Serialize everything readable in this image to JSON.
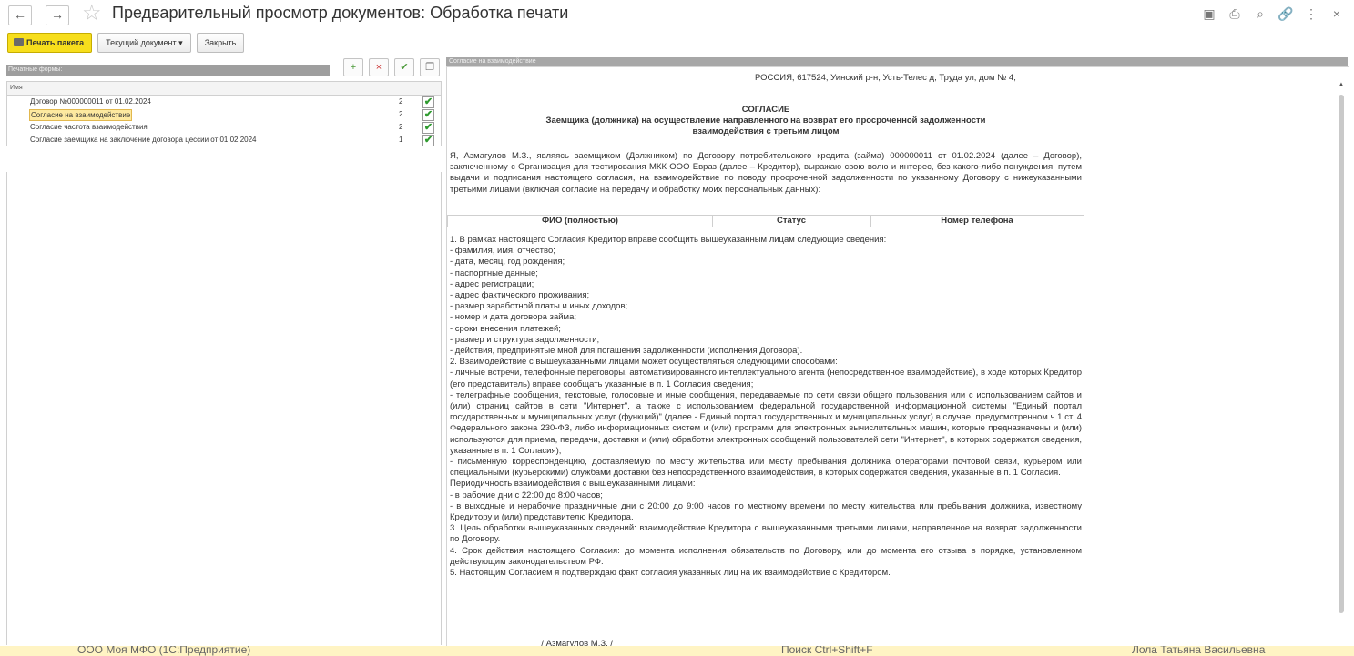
{
  "window": {
    "title": "Предварительный просмотр документов: Обработка печати",
    "nav_back": "←",
    "nav_forward": "→",
    "star": "☆",
    "header_icons": [
      "save-icon",
      "print-icon",
      "preview-icon",
      "link-icon",
      "more-icon",
      "close-icon"
    ],
    "header_icon_glyphs": [
      "▣",
      "⎙",
      "⌕",
      "🔗",
      "⋮",
      "×"
    ]
  },
  "toolbar": {
    "print_package": "Печать пакета",
    "current_document": "Текущий документ",
    "current_document_arrow": "▾",
    "close": "Закрыть"
  },
  "left_panel": {
    "header": "Печатные формы:",
    "icons": [
      "add-doc-icon",
      "delete-doc-icon",
      "check-all-icon",
      "copy-icon"
    ],
    "icon_glyphs": [
      "+",
      "×",
      "✔",
      "❐"
    ],
    "column_name": "Имя",
    "rows": [
      {
        "name": "Договор №000000011 от 01.02.2024",
        "count": "2",
        "checked": "✔"
      },
      {
        "name": "Согласие на взаимодействие",
        "count": "2",
        "checked": "✔"
      },
      {
        "name": "Согласие частота взаимодействия",
        "count": "2",
        "checked": "✔"
      },
      {
        "name": "Согласие заемщика на заключение договора цессии от 01.02.2024",
        "count": "1",
        "checked": "✔"
      }
    ]
  },
  "right_panel": {
    "header": "Согласие на взаимодействие"
  },
  "document": {
    "address": "РОССИЯ, 617524, Уинский р-н, Усть-Телес д, Труда ул, дом № 4,",
    "title": "СОГЛАСИЕ",
    "subtitle1": "Заемщика (должника) на осуществление направленного на возврат его просроченной задолженности",
    "subtitle2": "взаимодействия с третьим лицом",
    "intro": "Я, Азмагулов М.З., являясь заемщиком (Должником) по Договору потребительского кредита (займа) 000000011 от 01.02.2024 (далее – Договор), заключенному с Организация для тестирования МКК ООО Евраз (далее – Кредитор), выражаю свою волю и интерес, без какого-либо понуждения, путем выдачи и подписания настоящего согласия, на взаимодействие по поводу просроченной задолженности по указанному Договору с нижеуказанными третьими лицами (включая согласие на передачу и обработку моих персональных данных):",
    "table_headers": [
      "ФИО (полностью)",
      "Статус",
      "Номер телефона"
    ],
    "lines": [
      "1. В рамках настоящего Согласия Кредитор вправе сообщить вышеуказанным лицам следующие сведения:",
      "- фамилия, имя, отчество;",
      "- дата, месяц, год рождения;",
      "- паспортные данные;",
      "- адрес регистрации;",
      "- адрес фактического проживания;",
      "- размер заработной платы и иных доходов;",
      "- номер и дата договора займа;",
      "- сроки внесения платежей;",
      "- размер и структура задолженности;",
      "- действия, предпринятые мной для погашения задолженности (исполнения Договора).",
      "2. Взаимодействие с вышеуказанными лицами может осуществляться следующими способами:",
      "- личные встречи, телефонные переговоры, автоматизированного интеллектуального агента (непосредственное взаимодействие), в ходе которых Кредитор (его представитель) вправе сообщать указанные в п. 1 Согласия сведения;",
      "- телеграфные сообщения, текстовые, голосовые и иные сообщения, передаваемые по сети связи общего пользования или с использованием сайтов и (или) страниц сайтов в сети \"Интернет\", а также с использованием федеральной государственной информационной системы \"Единый портал государственных и муниципальных услуг (функций)\" (далее - Единый портал государственных и муниципальных услуг) в случае, предусмотренном ч.1 ст. 4 Федерального закона 230-ФЗ, либо информационных систем и (или) программ для электронных вычислительных машин, которые предназначены и (или) используются для приема, передачи, доставки и (или) обработки электронных сообщений пользователей сети \"Интернет\", в которых содержатся сведения, указанные в п. 1 Согласия);",
      "- письменную корреспонденцию, доставляемую по месту жительства или месту пребывания должника операторами почтовой связи, курьером или специальными (курьерскими) службами доставки без непосредственного взаимодействия, в которых содержатся сведения, указанные в п. 1 Согласия.",
      "   Периодичность взаимодействия с вышеуказанными лицами:",
      "-  в рабочие дни с 22:00 до 8:00 часов;",
      "- в выходные и нерабочие праздничные дни с 20:00 до 9:00 часов по местному времени по месту жительства или пребывания должника, известному Кредитору и (или) представителю Кредитора.",
      "3. Цель обработки вышеуказанных сведений: взаимодействие Кредитора с вышеуказанными третьими лицами, направленное на возврат задолженности по Договору.",
      "4. Срок действия настоящего Согласия: до момента исполнения обязательств по Договору, или до момента его отзыва в порядке, установленном действующим законодательством РФ.",
      "5. Настоящим Согласием я подтверждаю факт согласия указанных лиц на их взаимодействие с Кредитором."
    ],
    "signature": "___________________/ Азмагулов М.З. /"
  },
  "taskbar": {
    "app": "ООО Моя МФО  (1С:Предприятие)",
    "search": "Поиск Ctrl+Shift+F",
    "user": "Лола Татьяна Васильевна"
  }
}
